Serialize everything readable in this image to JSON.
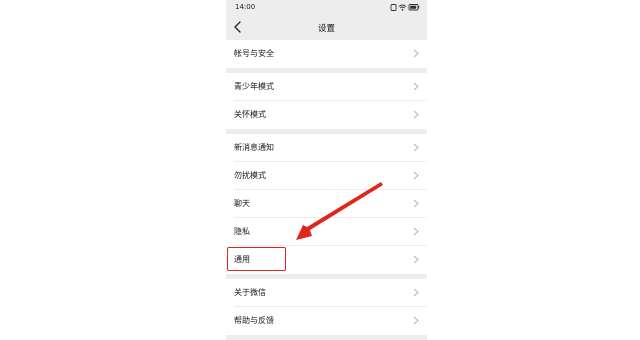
{
  "status_bar": {
    "time": "14:00"
  },
  "nav": {
    "title": "设置",
    "back_icon": "chevron-left-icon"
  },
  "groups": [
    {
      "items": [
        {
          "label": "帐号与安全"
        }
      ]
    },
    {
      "items": [
        {
          "label": "青少年模式"
        },
        {
          "label": "关怀模式"
        }
      ]
    },
    {
      "items": [
        {
          "label": "新消息通知"
        },
        {
          "label": "勿扰模式"
        },
        {
          "label": "聊天"
        },
        {
          "label": "隐私"
        },
        {
          "label": "通用"
        }
      ]
    },
    {
      "items": [
        {
          "label": "关于微信"
        },
        {
          "label": "帮助与反馈"
        }
      ]
    }
  ],
  "annotation": {
    "color": "#e1251b",
    "highlighted_item": "通用"
  },
  "colors": {
    "page_background": "#ededed",
    "cell_background": "#ffffff",
    "chevron": "#b2b2b2"
  }
}
